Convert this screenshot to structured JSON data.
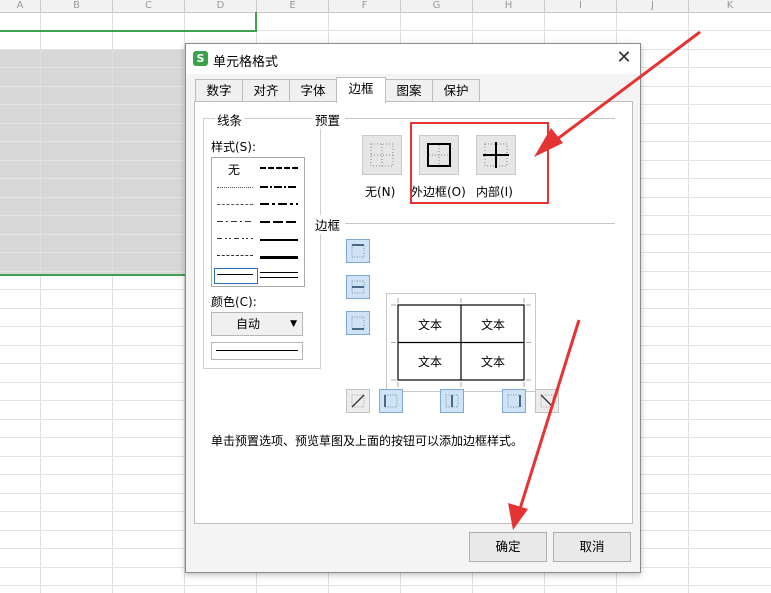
{
  "sheet": {
    "columns": [
      "A",
      "B",
      "C",
      "D",
      "E",
      "F",
      "G",
      "H",
      "I",
      "J",
      "K"
    ]
  },
  "dialog": {
    "app_icon": "S",
    "title": "单元格格式",
    "close_glyph": "✕",
    "tabs": [
      {
        "label": "数字",
        "active": false
      },
      {
        "label": "对齐",
        "active": false
      },
      {
        "label": "字体",
        "active": false
      },
      {
        "label": "边框",
        "active": true
      },
      {
        "label": "图案",
        "active": false
      },
      {
        "label": "保护",
        "active": false
      }
    ],
    "line": {
      "group_title": "线条",
      "style_label": "样式(S):",
      "style_none": "无",
      "color_label": "颜色(C):",
      "color_value": "自动"
    },
    "preset": {
      "group_title": "预置",
      "items": [
        {
          "label": "无(N)",
          "icon": "border-none-icon"
        },
        {
          "label": "外边框(O)",
          "icon": "border-outline-icon"
        },
        {
          "label": "内部(I)",
          "icon": "border-inside-icon"
        }
      ]
    },
    "border": {
      "group_title": "边框",
      "preview_text": "文本"
    },
    "hint": "单击预置选项、预览草图及上面的按钮可以添加边框样式。",
    "ok_label": "确定",
    "cancel_label": "取消"
  },
  "colors": {
    "annotation": "#e53333",
    "selection": "#3fa34d",
    "active_button": "#cfe3f6"
  }
}
